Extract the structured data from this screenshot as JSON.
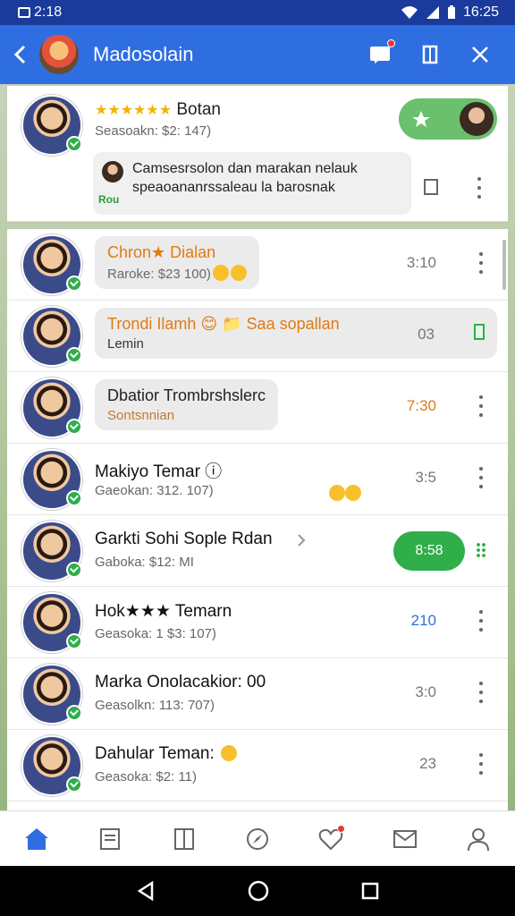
{
  "status_bar": {
    "time_left": "2:18",
    "time_right": "16:25"
  },
  "app_bar": {
    "title": "Madosolain"
  },
  "top_card": {
    "stars": "★★★★★★",
    "name": "Botan",
    "subtitle": "Seasoakn: $2: 147)",
    "message": "Camsesrsolon dan marakan nelauk speaoananrssaleau la barosnak",
    "message_tag": "Rou"
  },
  "contacts": [
    {
      "name": "Chron★ Dialan",
      "sub": "Raroke: $23 100)",
      "time": "3:10",
      "bubble": true
    },
    {
      "name": "Trondi Ilamh 😊 📁 Saa sopallan",
      "sub": "Lemin",
      "time": "03",
      "bubble": true
    },
    {
      "name": "Dbatior Trombrshslerc",
      "sub": "Sontsnnian",
      "time": "7:30",
      "bubble": true
    },
    {
      "name": "Makiyo Temar ⓘ",
      "sub": "Gaeokan: 312. 107)",
      "time": "3:5",
      "bubble": false
    },
    {
      "name": "Garkti Sohi Sople Rdan",
      "sub": "Gaboka: $12: MI",
      "time": "8:58",
      "bubble": false
    },
    {
      "name": "Hok★★★ Temarn",
      "sub": "Geasoka: 1 $3: 107)",
      "time": "210",
      "bubble": false
    },
    {
      "name": "Marka Onolacakior: 00",
      "sub": "Geasolkn: 113: 707)",
      "time": "3:0",
      "bubble": false
    },
    {
      "name": "Dahular Teman:",
      "sub": "Geasoka: $2: 11)",
      "time": "23",
      "bubble": false
    }
  ],
  "colors": {
    "app_bar": "#2f6ee0",
    "status_bar": "#1a3a9c",
    "online": "#2fae4a"
  }
}
